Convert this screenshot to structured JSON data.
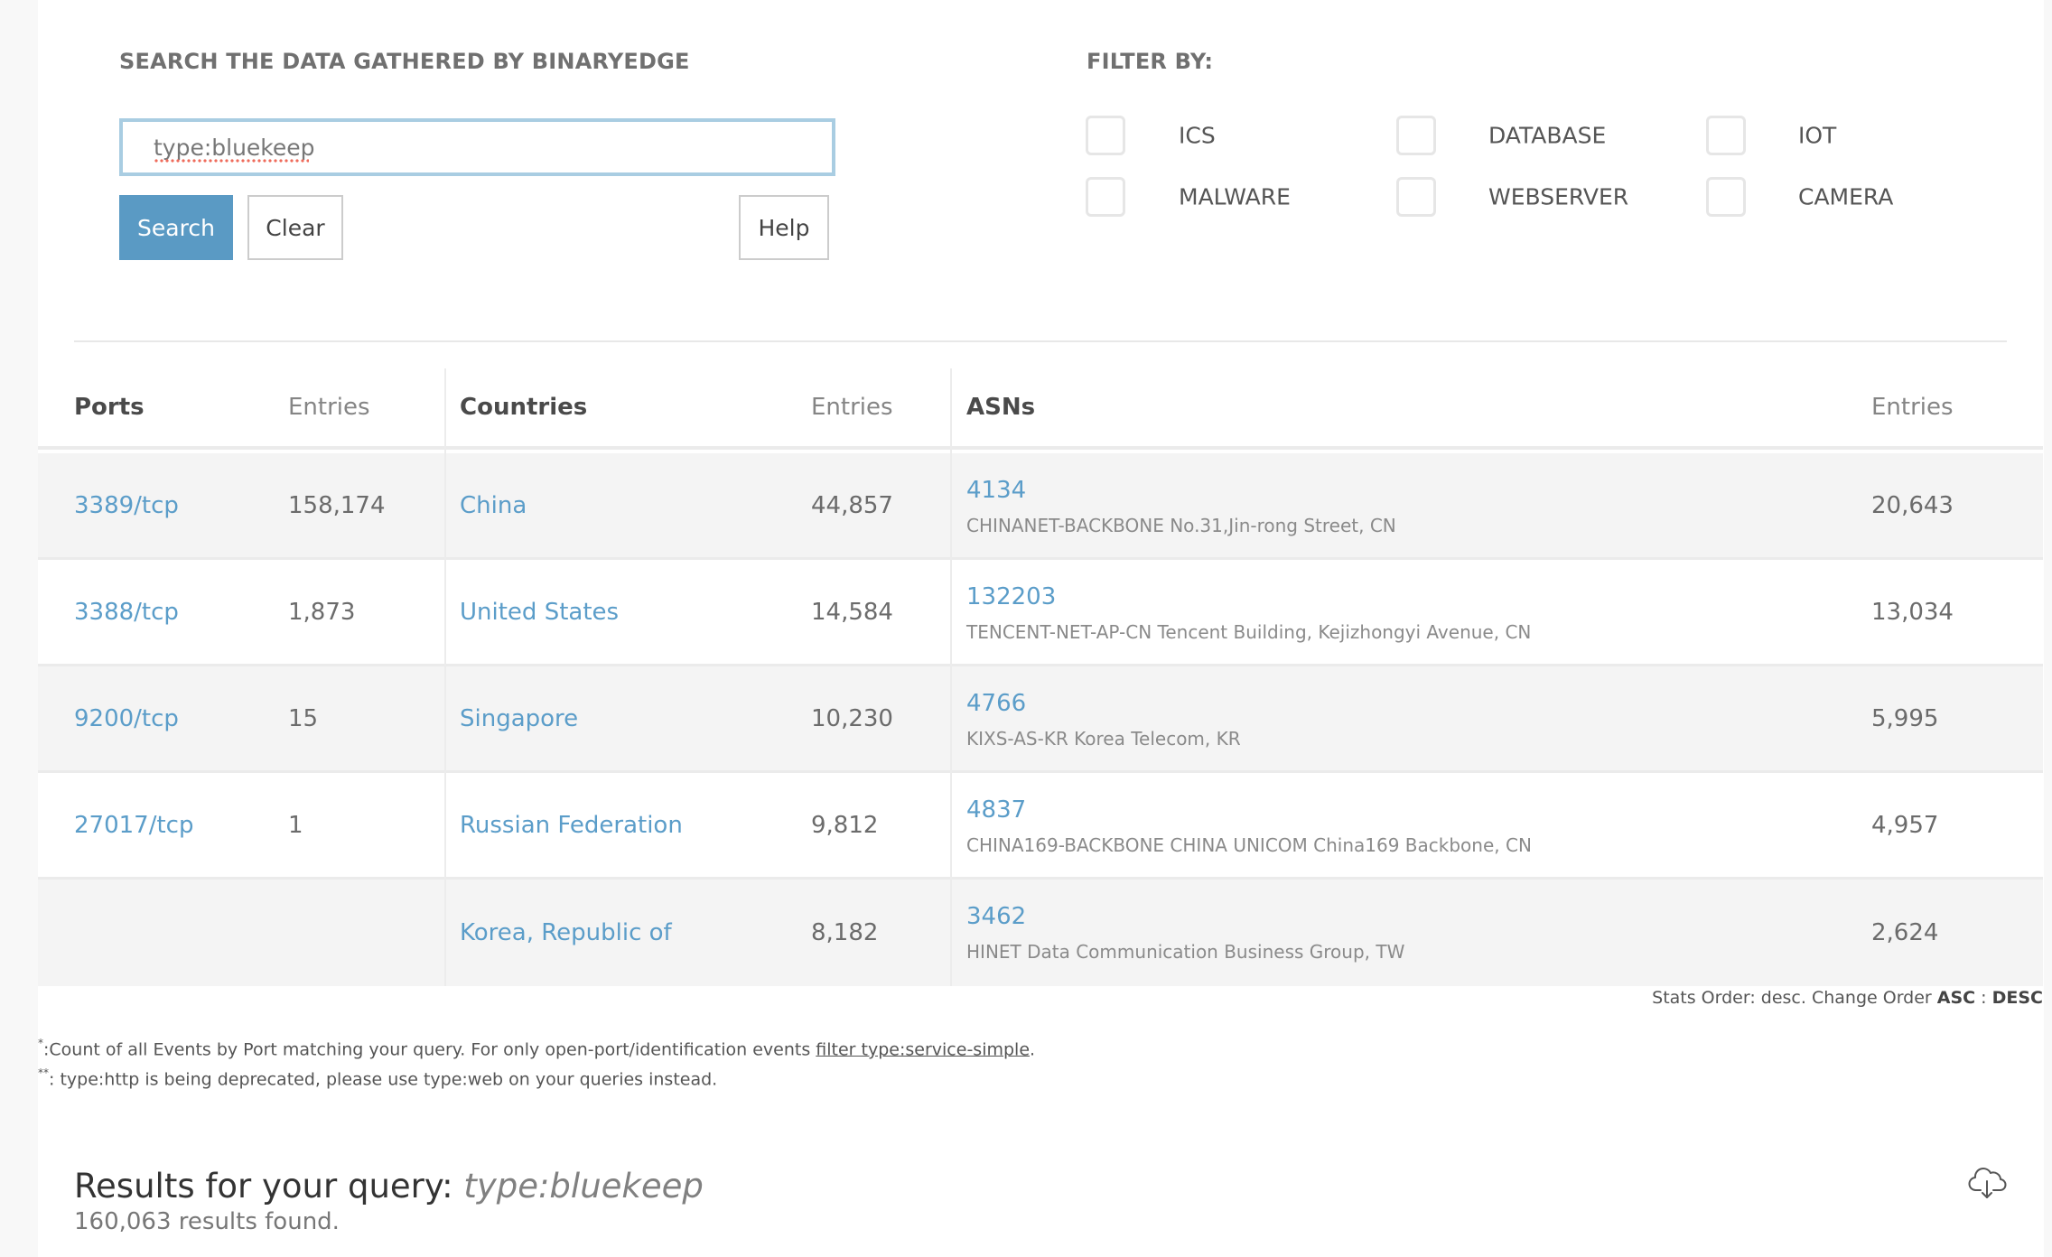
{
  "search": {
    "heading": "SEARCH THE DATA GATHERED BY BINARYEDGE",
    "query_value": "type:bluekeep",
    "search_label": "Search",
    "clear_label": "Clear",
    "help_label": "Help"
  },
  "filter": {
    "heading": "FILTER BY:",
    "options": [
      {
        "label": "ICS",
        "checked": false
      },
      {
        "label": "DATABASE",
        "checked": false
      },
      {
        "label": "IOT",
        "checked": false
      },
      {
        "label": "MALWARE",
        "checked": false
      },
      {
        "label": "WEBSERVER",
        "checked": false
      },
      {
        "label": "CAMERA",
        "checked": false
      }
    ]
  },
  "stats": {
    "headers": {
      "ports": "Ports",
      "ports_entries": "Entries",
      "countries": "Countries",
      "countries_entries": "Entries",
      "asns": "ASNs",
      "asns_entries": "Entries"
    },
    "rows": [
      {
        "port": "3389/tcp",
        "port_entries": "158,174",
        "country": "China",
        "country_entries": "44,857",
        "asn": "4134",
        "asn_name": "CHINANET-BACKBONE No.31,Jin-rong Street, CN",
        "asn_entries": "20,643"
      },
      {
        "port": "3388/tcp",
        "port_entries": "1,873",
        "country": "United States",
        "country_entries": "14,584",
        "asn": "132203",
        "asn_name": "TENCENT-NET-AP-CN Tencent Building, Kejizhongyi Avenue, CN",
        "asn_entries": "13,034"
      },
      {
        "port": "9200/tcp",
        "port_entries": "15",
        "country": "Singapore",
        "country_entries": "10,230",
        "asn": "4766",
        "asn_name": "KIXS-AS-KR Korea Telecom, KR",
        "asn_entries": "5,995"
      },
      {
        "port": "27017/tcp",
        "port_entries": "1",
        "country": "Russian Federation",
        "country_entries": "9,812",
        "asn": "4837",
        "asn_name": "CHINA169-BACKBONE CHINA UNICOM China169 Backbone, CN",
        "asn_entries": "4,957"
      },
      {
        "port": "",
        "port_entries": "",
        "country": "Korea, Republic of",
        "country_entries": "8,182",
        "asn": "3462",
        "asn_name": "HINET Data Communication Business Group, TW",
        "asn_entries": "2,624"
      }
    ],
    "order": {
      "prefix": "Stats Order: desc. Change Order ",
      "asc": "ASC",
      "sep": " : ",
      "desc": "DESC"
    }
  },
  "footnotes": {
    "one_mark": "*",
    "one_text": ":Count of all Events by Port matching your query. For only open-port/identification events ",
    "one_link": "filter type:service-simple",
    "one_end": ".",
    "two_mark": "**",
    "two_text": ": type:http is being deprecated, please use type:web on your queries instead."
  },
  "results": {
    "title_prefix": "Results for your query: ",
    "query": "type:bluekeep",
    "count_text": "160,063 results found.",
    "download_icon": "cloud-download-icon"
  }
}
